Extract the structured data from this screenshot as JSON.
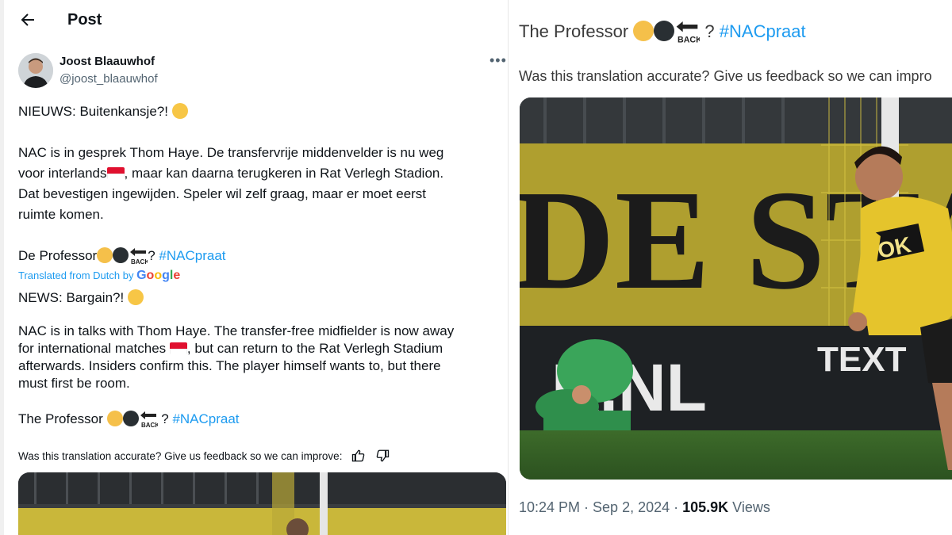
{
  "header": {
    "title": "Post"
  },
  "author": {
    "name": "Joost Blaauwhof",
    "handle": "@joost_blaauwhof"
  },
  "original": {
    "line1": "NIEUWS: Buitenkansje?!",
    "para1_l1": "NAC is in gesprek Thom Haye. De transfervrije middenvelder is nu weg",
    "para1_l2a": "voor interlands",
    "para1_l2b": ", maar kan daarna terugkeren in Rat Verlegh Stadion.",
    "para1_l3": "Dat bevestigen ingewijden. Speler wil zelf graag, maar er moet eerst",
    "para1_l4": "ruimte komen.",
    "sig_prefix": "De Professor",
    "sig_suffix": "?",
    "hashtag": "#NACpraat"
  },
  "translation": {
    "translated_from": "Translated from Dutch by",
    "google": "Google",
    "line1": "NEWS: Bargain?!",
    "para1_l1": "NAC is in talks with Thom Haye. The transfer-free midfielder is now away",
    "para1_l2a": "for international matches",
    "para1_l2b": ", but can return to the Rat Verlegh Stadium",
    "para1_l3": "afterwards. Insiders confirm this. The player himself wants to, but there",
    "para1_l4": "must first be room.",
    "sig_prefix": "The Professor",
    "sig_suffix": "?",
    "hashtag": "#NACpraat",
    "feedback": "Was this translation accurate? Give us feedback so we can improve:"
  },
  "right": {
    "sig_prefix": "The Professor",
    "sig_suffix": "?",
    "hashtag": "#NACpraat",
    "feedback": "Was this translation accurate? Give us feedback so we can impro",
    "time": "10:24 PM · Sep 2, 2024 · ",
    "views_count": "105.9K",
    "views_label": " Views"
  },
  "photo": {
    "banner_text": "DE STA",
    "ad_text": "K.NL",
    "ad_text2": "TEXT",
    "shirt_text": "OK"
  },
  "icons": {
    "back": "back-arrow-icon",
    "more": "more-icon",
    "thumbs_up": "thumbs-up-icon",
    "thumbs_down": "thumbs-down-icon",
    "back_badge": "back-arrow-emoji",
    "flag": "indonesia-flag-emoji",
    "exploding_head": "exploding-head-emoji"
  },
  "colors": {
    "hashtag": "#1d9bf0",
    "yellow_dot": "#f5c04a",
    "black_dot": "#292f33"
  }
}
